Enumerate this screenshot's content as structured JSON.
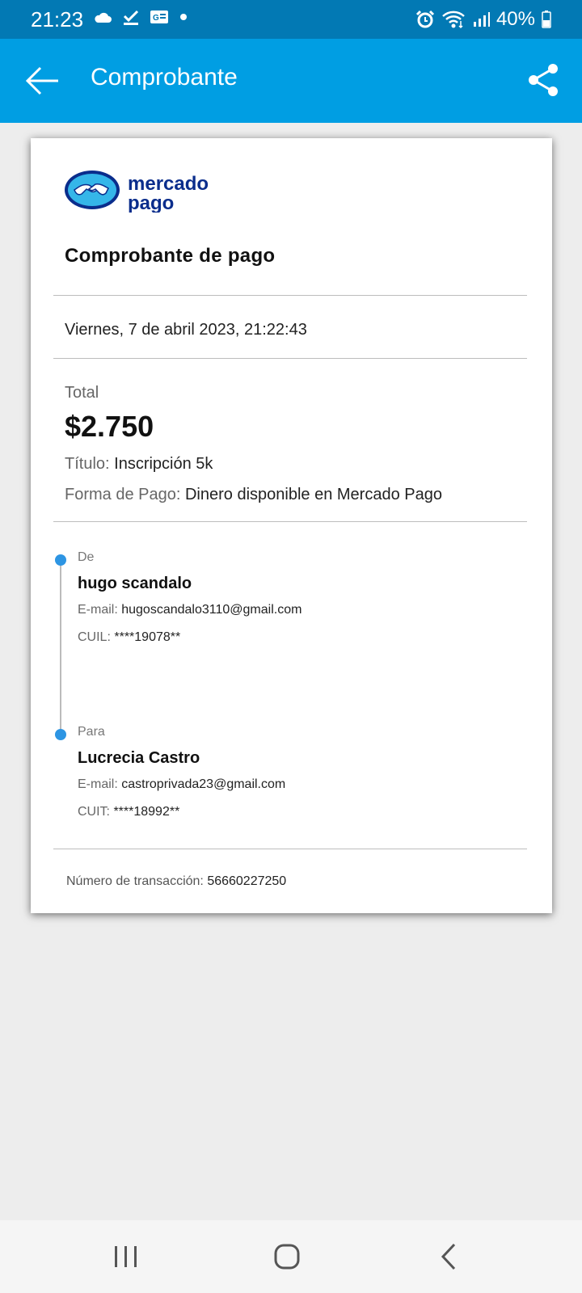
{
  "status_bar": {
    "time": "21:23",
    "battery": "40%",
    "icons": [
      "cloud-icon",
      "check-icon",
      "news-icon",
      "dot-icon",
      "alarm-icon",
      "wifi-icon",
      "signal-icon",
      "battery-icon"
    ]
  },
  "app_bar": {
    "title": "Comprobante",
    "colors": {
      "background": "#009ee3",
      "status": "#0279b4"
    }
  },
  "receipt": {
    "brand_line1": "mercado",
    "brand_line2": "pago",
    "title": "Comprobante de pago",
    "date": "Viernes, 7 de abril 2023, 21:22:43",
    "total_label": "Total",
    "total_amount": "$2.750",
    "titulo_label": "Título:",
    "titulo_value": "Inscripción 5k",
    "forma_label": "Forma de Pago:",
    "forma_value": "Dinero disponible en Mercado Pago",
    "from": {
      "label": "De",
      "name": "hugo scandalo",
      "email_label": "E-mail:",
      "email": "hugoscandalo3110@gmail.com",
      "id_label": "CUIL:",
      "id": "****19078**"
    },
    "to": {
      "label": "Para",
      "name": "Lucrecia Castro",
      "email_label": "E-mail:",
      "email": "castroprivada23@gmail.com",
      "id_label": "CUIT:",
      "id": "****18992**"
    },
    "transaction_label": "Número de transacción:",
    "transaction_number": "56660227250"
  },
  "nav": {
    "items": [
      "recent-apps-icon",
      "home-icon",
      "back-nav-icon"
    ]
  }
}
